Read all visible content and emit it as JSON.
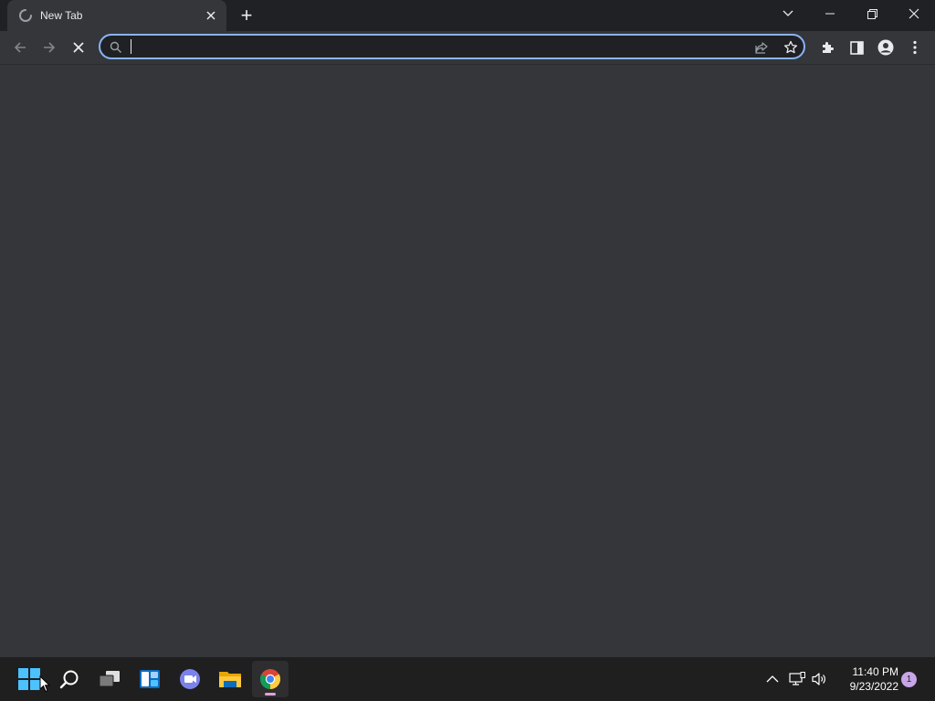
{
  "browser": {
    "tab": {
      "title": "New Tab",
      "loading": true
    },
    "new_tab_symbol": "+",
    "window_controls": [
      "tab-search-icon",
      "minimize-icon",
      "restore-icon",
      "close-icon"
    ],
    "toolbar": {
      "back": "back-arrow-icon",
      "forward": "forward-arrow-icon",
      "stop": "stop-icon",
      "omnibox": {
        "value": "",
        "placeholder": ""
      },
      "right_icons": [
        "extensions-icon",
        "side-panel-icon",
        "profile-icon",
        "menu-icon"
      ]
    },
    "colors": {
      "frame": "#202124",
      "toolbar": "#35363a",
      "focus_ring": "#8ab4f8"
    }
  },
  "taskbar": {
    "apps": [
      {
        "name": "start-button",
        "icon": "windows-logo-icon"
      },
      {
        "name": "search-button",
        "icon": "search-icon"
      },
      {
        "name": "task-view-button",
        "icon": "task-view-icon"
      },
      {
        "name": "widgets-button",
        "icon": "widgets-icon"
      },
      {
        "name": "teams-chat-button",
        "icon": "chat-icon"
      },
      {
        "name": "file-explorer-button",
        "icon": "folder-icon"
      },
      {
        "name": "chrome-button",
        "icon": "chrome-icon",
        "active": true
      }
    ],
    "tray": {
      "icons": [
        "show-hidden-icons-chevron",
        "network-icon",
        "volume-icon"
      ],
      "time": "11:40 PM",
      "date": "9/23/2022",
      "notification_count": "1"
    }
  }
}
